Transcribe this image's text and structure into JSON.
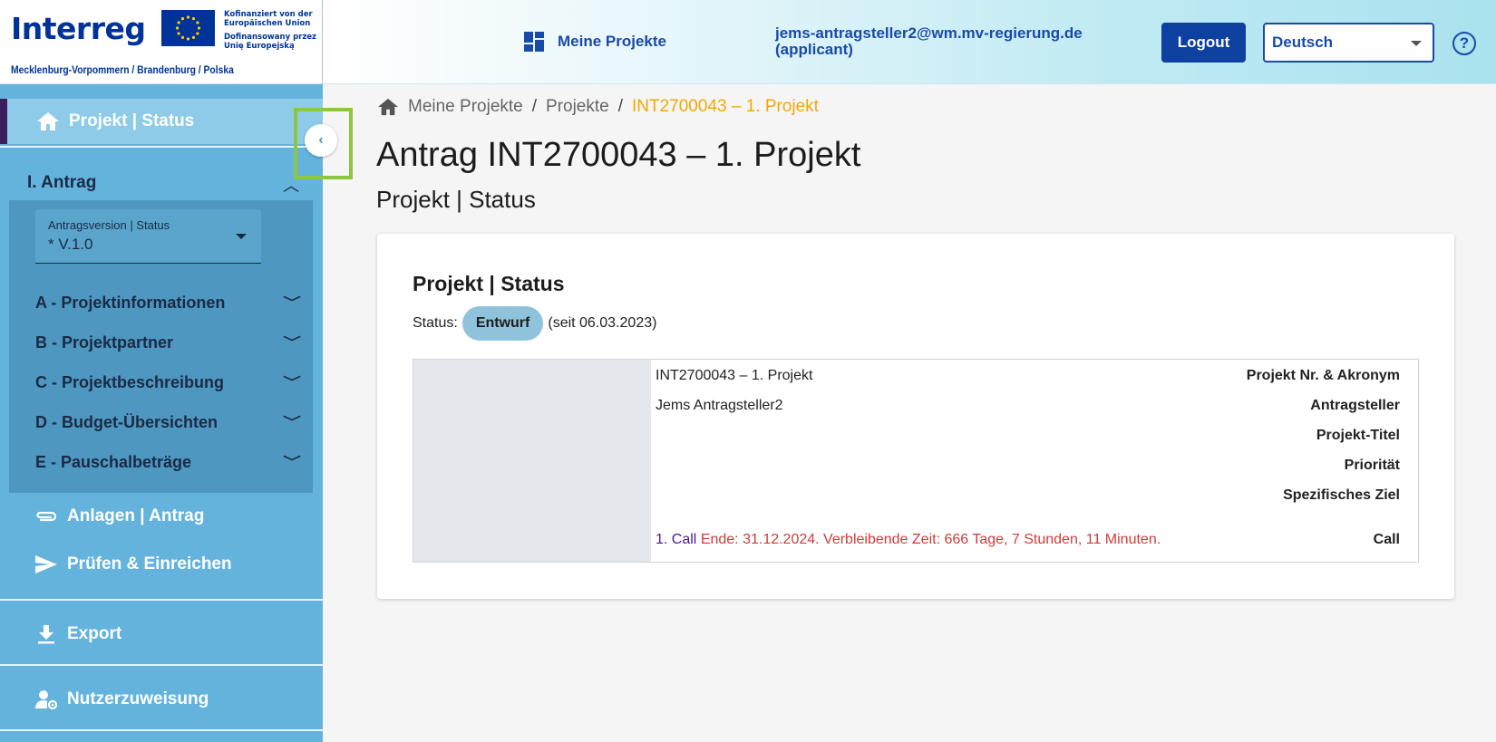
{
  "header": {
    "logo_word": "Interreg",
    "eu_lines": [
      "Kofinanziert von der",
      "Europäischen Union",
      "Dofinansowany przez",
      "Unię Europejską"
    ],
    "logo_sub": "Mecklenburg-Vorpommern / Brandenburg / Polska",
    "nav_projects": "Meine Projekte",
    "user_email": "jems-antragsteller2@wm.mv-regierung.de",
    "user_role": "(applicant)",
    "logout_label": "Logout",
    "language": "Deutsch",
    "help_label": "?"
  },
  "sidebar": {
    "active_item": "Projekt | Status",
    "section_title": "I. Antrag",
    "version_label": "Antragsversion | Status",
    "version_value": "* V.1.0",
    "panel_items": [
      {
        "label": "A - Projektinformationen"
      },
      {
        "label": "B - Projektpartner"
      },
      {
        "label": "C - Projektbeschreibung"
      },
      {
        "label": "D - Budget-Übersichten"
      },
      {
        "label": "E - Pauschalbeträge"
      }
    ],
    "attachments": "Anlagen | Antrag",
    "check_submit": "Prüfen & Einreichen",
    "export": "Export",
    "user_assignment": "Nutzerzuweisung"
  },
  "breadcrumb": {
    "home": "Meine Projekte",
    "projects": "Projekte",
    "current": "INT2700043 – 1. Projekt"
  },
  "page": {
    "title": "Antrag INT2700043 – 1. Projekt",
    "subtitle": "Projekt | Status"
  },
  "card": {
    "title": "Projekt | Status",
    "status_label": "Status:",
    "status_value": "Entwurf",
    "status_since": "(seit 06.03.2023)",
    "rows": [
      {
        "label": "Projekt Nr. & Akronym",
        "value": "INT2700043 – 1. Projekt"
      },
      {
        "label": "Antragsteller",
        "value": "Jems Antragsteller2"
      },
      {
        "label": "Projekt-Titel",
        "value": ""
      },
      {
        "label": "Priorität",
        "value": ""
      },
      {
        "label": "Spezifisches Ziel",
        "value": ""
      },
      {
        "label": "Call",
        "value": ""
      }
    ],
    "call_name": "1. Call",
    "call_deadline": "Ende: 31.12.2024. Verbleibende Zeit: 666 Tage, 7 Stunden, 11 Minuten."
  },
  "colors": {
    "brand": "#003399",
    "accent_button": "#0e40a0",
    "sidebar": "#63b3dd",
    "breadcrumb_current": "#f2a900",
    "deadline": "#d03b3b",
    "highlight_box": "#8dc63f"
  }
}
